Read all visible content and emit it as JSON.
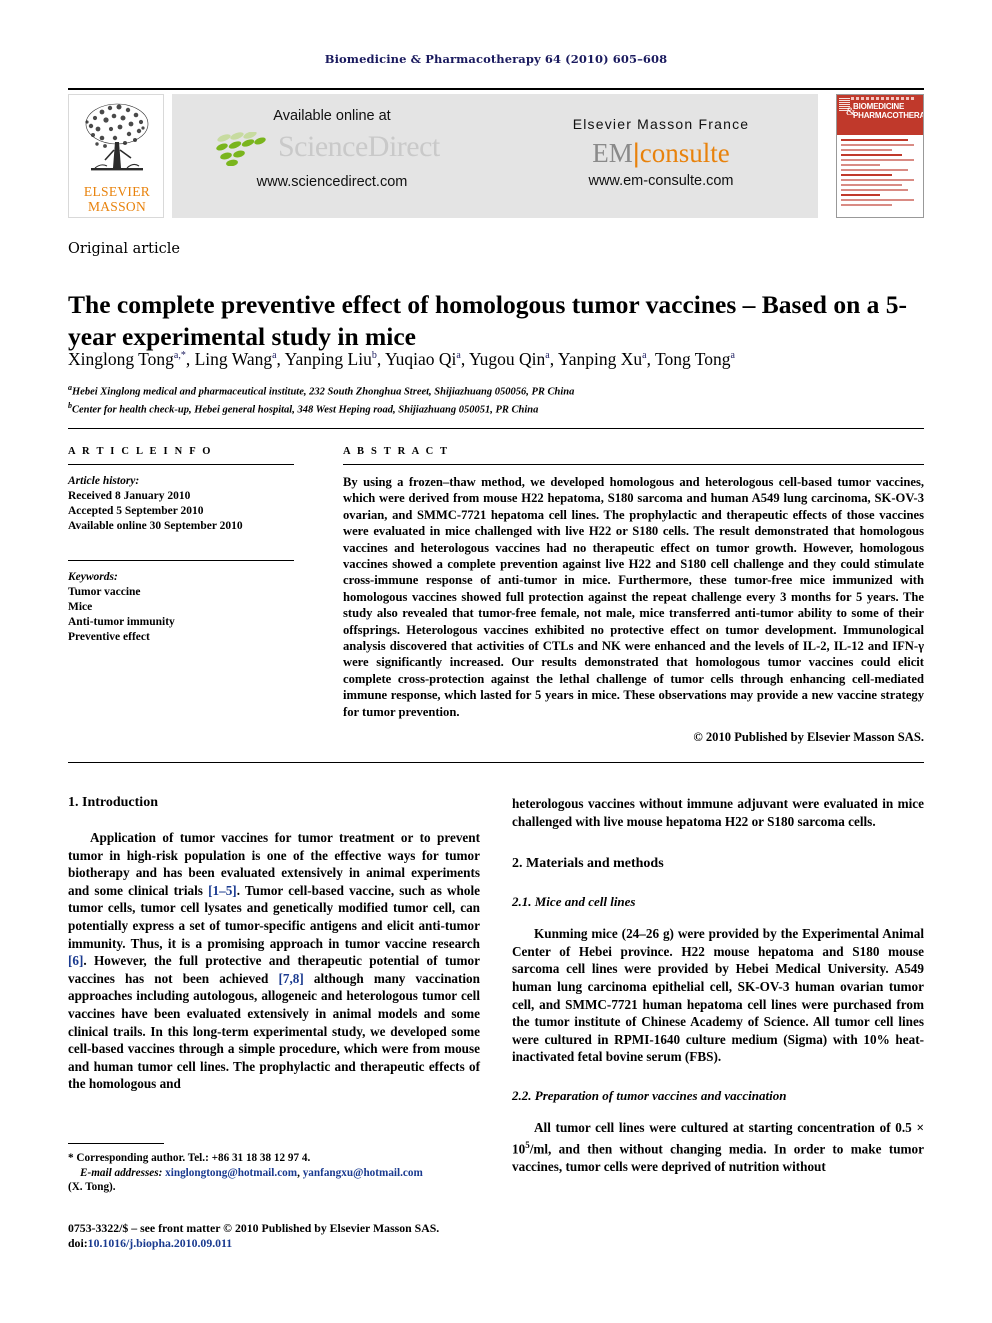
{
  "running_head": "Biomedicine & Pharmacotherapy 64 (2010) 605–608",
  "banner": {
    "publisher_logo": {
      "line1": "ELSEVIER",
      "line2": "MASSON"
    },
    "sciencedirect": {
      "available_text": "Available online at",
      "wordmark": "ScienceDirect",
      "url": "www.sciencedirect.com"
    },
    "emconsulte": {
      "imprint": "Elsevier Masson France",
      "mark_left": "EM",
      "mark_bar": "|",
      "mark_right": "consulte",
      "url": "www.em-consulte.com"
    },
    "cover": {
      "title_line1": "BIOMEDICINE",
      "title_line2": "PHARMACOTHERAPY",
      "ampersand": "&"
    }
  },
  "article": {
    "type": "Original article",
    "title": "The complete preventive effect of homologous tumor vaccines – Based on a 5-year experimental study in mice",
    "authors_html": "Xinglong Tong<sup>a,*</sup>, Ling Wang<sup>a</sup>, Yanping Liu<sup>b</sup>, Yuqiao Qi<sup>a</sup>, Yugou Qin<sup>a</sup>, Yanping Xu<sup>a</sup>, Tong Tong<sup>a</sup>",
    "affiliations": [
      {
        "mark": "a",
        "text": "Hebei Xinglong medical and pharmaceutical institute, 232 South Zhonghua Street, Shijiazhuang 050056, PR China"
      },
      {
        "mark": "b",
        "text": "Center for health check-up, Hebei general hospital, 348 West Heping road, Shijiazhuang 050051, PR China"
      }
    ]
  },
  "article_info": {
    "heading": "A R T I C L E  I N F O",
    "history_label": "Article history:",
    "history": [
      "Received 8 January 2010",
      "Accepted 5 September 2010",
      "Available online 30 September 2010"
    ],
    "keywords_label": "Keywords:",
    "keywords": [
      "Tumor vaccine",
      "Mice",
      "Anti-tumor immunity",
      "Preventive effect"
    ]
  },
  "abstract": {
    "heading": "A B S T R A C T",
    "text": "By using a frozen–thaw method, we developed homologous and heterologous cell-based tumor vaccines, which were derived from mouse H22 hepatoma, S180 sarcoma and human A549 lung carcinoma, SK-OV-3 ovarian, and SMMC-7721 hepatoma cell lines. The prophylactic and therapeutic effects of those vaccines were evaluated in mice challenged with live H22 or S180 cells. The result demonstrated that homologous vaccines and heterologous vaccines had no therapeutic effect on tumor growth. However, homologous vaccines showed a complete prevention against live H22 and S180 cell challenge and they could stimulate cross-immune response of anti-tumor in mice. Furthermore, these tumor-free mice immunized with homologous vaccines showed full protection against the repeat challenge every 3 months for 5 years. The study also revealed that tumor-free female, not male, mice transferred anti-tumor ability to some of their offsprings. Heterologous vaccines exhibited no protective effect on tumor development. Immunological analysis discovered that activities of CTLs and NK were enhanced and the levels of IL-2, IL-12 and IFN-γ were significantly increased. Our results demonstrated that homologous tumor vaccines could elicit complete cross-protection against the lethal challenge of tumor cells through enhancing cell-mediated immune response, which lasted for 5 years in mice. These observations may provide a new vaccine strategy for tumor prevention.",
    "copyright": "© 2010 Published by Elsevier Masson SAS."
  },
  "body": {
    "intro_heading": "1. Introduction",
    "intro_p1_a": "Application of tumor vaccines for tumor treatment or to prevent tumor in high-risk population is one of the effective ways for tumor biotherapy and has been evaluated extensively in animal experiments and some clinical trials ",
    "intro_ref1": "[1–5]",
    "intro_p1_b": ". Tumor cell-based vaccine, such as whole tumor cells, tumor cell lysates and genetically modified tumor cell, can potentially express a set of tumor-specific antigens and elicit anti-tumor immunity. Thus, it is a promising approach in tumor vaccine research ",
    "intro_ref2": "[6]",
    "intro_p1_c": ". However, the full protective and therapeutic potential of tumor vaccines has not been achieved ",
    "intro_ref3": "[7,8]",
    "intro_p1_d": " although many vaccination approaches including autologous, allogeneic and heterologous tumor cell vaccines have been evaluated extensively in animal models and some clinical trails. In this long-term experimental study, we developed some cell-based vaccines through a simple procedure, which were from mouse and human tumor cell lines. The prophylactic and therapeutic effects of the homologous and",
    "intro_p1_cont": "heterologous vaccines without immune adjuvant were evaluated in mice challenged with live mouse hepatoma H22 or S180 sarcoma cells.",
    "methods_heading": "2. Materials and methods",
    "sub21_heading": "2.1. Mice and cell lines",
    "sub21_text": "Kunming mice (24–26 g) were provided by the Experimental Animal Center of Hebei province. H22 mouse hepatoma and S180 mouse sarcoma cell lines were provided by Hebei Medical University. A549 human lung carcinoma epithelial cell, SK-OV-3 human ovarian tumor cell, and SMMC-7721 human hepatoma cell lines were purchased from the tumor institute of Chinese Academy of Science. All tumor cell lines were cultured in RPMI-1640 culture medium (Sigma) with 10% heat-inactivated fetal bovine serum (FBS).",
    "sub22_heading": "2.2. Preparation of tumor vaccines and vaccination",
    "sub22_text_a": "All tumor cell lines were cultured at starting concentration of 0.5 × 10",
    "sub22_sup": "5",
    "sub22_text_b": "/ml, and then without changing media. In order to make tumor vaccines, tumor cells were deprived of nutrition without"
  },
  "footnotes": {
    "corresponding": "* Corresponding author. Tel.: +86 31 18 38 12 97 4.",
    "email_label": "E-mail addresses:",
    "email1": "xinglongtong@hotmail.com",
    "email_sep": ", ",
    "email2": "yanfangxu@hotmail.com",
    "email_owner": "(X. Tong)."
  },
  "imprint": {
    "issn_line": "0753-3322/$ – see front matter © 2010 Published by Elsevier Masson SAS.",
    "doi_label": "doi:",
    "doi_value": "10.1016/j.biopha.2010.09.011"
  },
  "colors": {
    "running_head": "#1a1a5e",
    "accent_orange": "#e8820c",
    "link_blue": "#1a3a8f",
    "cover_red": "#c0392b"
  }
}
